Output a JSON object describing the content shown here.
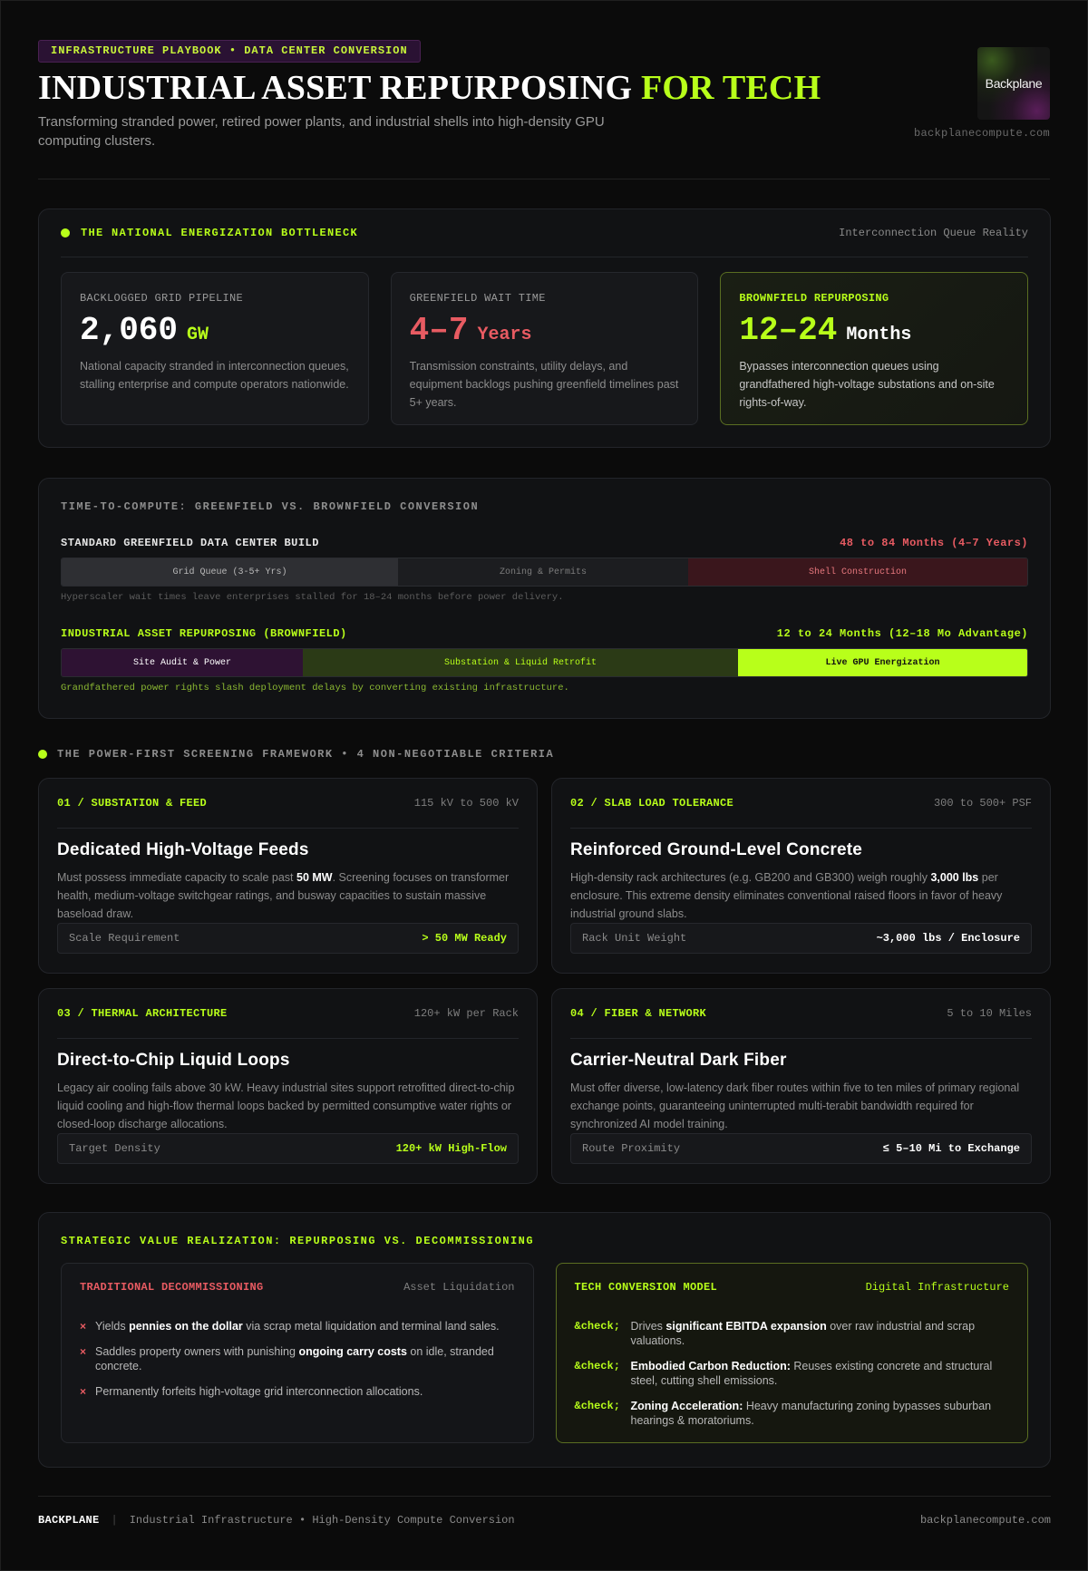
{
  "header": {
    "tag": "INFRASTRUCTURE PLAYBOOK • DATA CENTER CONVERSION",
    "title_main": "INDUSTRIAL ASSET REPURPOSING",
    "title_accent": "FOR TECH",
    "subtitle": "Transforming stranded power, retired power plants, and industrial shells into high-density GPU computing clusters.",
    "logo_text": "Backplane",
    "domain": "backplanecompute.com"
  },
  "bottleneck": {
    "title": "THE NATIONAL ENERGIZATION BOTTLENECK",
    "subtitle": "Interconnection Queue Reality",
    "stats": [
      {
        "label": "BACKLOGGED GRID PIPELINE",
        "value": "2,060",
        "unit": "GW",
        "desc": "National capacity stranded in interconnection queues, stalling enterprise and compute operators nationwide."
      },
      {
        "label": "GREENFIELD WAIT TIME",
        "value": "4–7",
        "unit": "Years",
        "desc": "Transmission constraints, utility delays, and equipment backlogs pushing greenfield timelines past 5+ years."
      },
      {
        "label": "BROWNFIELD REPURPOSING",
        "value": "12–24",
        "unit": "Months",
        "desc": "Bypasses interconnection queues using grandfathered high-voltage substations and on-site rights-of-way."
      }
    ]
  },
  "timeline": {
    "title": "TIME-TO-COMPUTE: GREENFIELD VS. BROWNFIELD CONVERSION",
    "greenfield": {
      "label": "STANDARD GREENFIELD DATA CENTER BUILD",
      "range": "48 to 84 Months (4–7 Years)",
      "segments": [
        "Grid Queue (3-5+ Yrs)",
        "Zoning & Permits",
        "Shell Construction"
      ],
      "note": "Hyperscaler wait times leave enterprises stalled for 18–24 months before power delivery."
    },
    "brownfield": {
      "label": "INDUSTRIAL ASSET REPURPOSING (BROWNFIELD)",
      "range": "12 to 24 Months (12–18 Mo Advantage)",
      "segments": [
        "Site Audit & Power",
        "Substation & Liquid Retrofit",
        "Live GPU Energization"
      ],
      "note": "Grandfathered power rights slash deployment delays by converting existing infrastructure."
    }
  },
  "criteria": {
    "title": "THE POWER-FIRST SCREENING FRAMEWORK • 4 NON-NEGOTIABLE CRITERIA",
    "items": [
      {
        "key": "01 / SUBSTATION & FEED",
        "spec": "115 kV to 500 kV",
        "heading": "Dedicated High-Voltage Feeds",
        "desc_a": "Must possess immediate capacity to scale past ",
        "desc_b": "50 MW",
        "desc_c": ". Screening focuses on transformer health, medium-voltage switchgear ratings, and busway capacities to sustain massive baseload draw.",
        "foot_label": "Scale Requirement",
        "foot_value": "> 50 MW Ready"
      },
      {
        "key": "02 / SLAB LOAD TOLERANCE",
        "spec": "300 to 500+ PSF",
        "heading": "Reinforced Ground-Level Concrete",
        "desc_a": "High-density rack architectures (e.g. GB200 and GB300) weigh roughly ",
        "desc_b": "3,000 lbs",
        "desc_c": " per enclosure. This extreme density eliminates conventional raised floors in favor of heavy industrial ground slabs.",
        "foot_label": "Rack Unit Weight",
        "foot_value": "~3,000 lbs / Enclosure"
      },
      {
        "key": "03 / THERMAL ARCHITECTURE",
        "spec": "120+ kW per Rack",
        "heading": "Direct-to-Chip Liquid Loops",
        "desc_a": "Legacy air cooling fails above 30 kW. Heavy industrial sites support retrofitted direct-to-chip liquid cooling and high-flow thermal loops backed by permitted consumptive water rights or closed-loop discharge allocations.",
        "desc_b": "",
        "desc_c": "",
        "foot_label": "Target Density",
        "foot_value": "120+ kW High-Flow"
      },
      {
        "key": "04 / FIBER & NETWORK",
        "spec": "5 to 10 Miles",
        "heading": "Carrier-Neutral Dark Fiber",
        "desc_a": "Must offer diverse, low-latency dark fiber routes within five to ten miles of primary regional exchange points, guaranteeing uninterrupted multi-terabit bandwidth required for synchronized AI model training.",
        "desc_b": "",
        "desc_c": "",
        "foot_label": "Route Proximity",
        "foot_value": "≤ 5–10 Mi to Exchange"
      }
    ]
  },
  "strategic": {
    "title": "STRATEGIC VALUE REALIZATION: REPURPOSING VS. DECOMMISSIONING",
    "traditional": {
      "title": "TRADITIONAL DECOMMISSIONING",
      "tag": "Asset Liquidation",
      "marker": "×",
      "items": [
        {
          "a": "Yields ",
          "b": "pennies on the dollar",
          "c": " via scrap metal liquidation and terminal land sales."
        },
        {
          "a": "Saddles property owners with punishing ",
          "b": "ongoing carry costs",
          "c": " on idle, stranded concrete."
        },
        {
          "a": "Permanently forfeits high-voltage grid interconnection allocations.",
          "b": "",
          "c": ""
        }
      ]
    },
    "tech": {
      "title": "TECH CONVERSION MODEL",
      "tag": "Digital Infrastructure",
      "marker": "&check;",
      "items": [
        {
          "a": "Drives ",
          "b": "significant EBITDA expansion",
          "c": " over raw industrial and scrap valuations."
        },
        {
          "a": "",
          "b": "Embodied Carbon Reduction:",
          "c": " Reuses existing concrete and structural steel, cutting shell emissions."
        },
        {
          "a": "",
          "b": "Zoning Acceleration:",
          "c": " Heavy manufacturing zoning bypasses suburban hearings & moratoriums."
        }
      ]
    }
  },
  "footer": {
    "brand": "BACKPLANE",
    "separator": "|",
    "tagline": "Industrial Infrastructure • High-Density Compute Conversion",
    "domain": "backplanecompute.com"
  }
}
